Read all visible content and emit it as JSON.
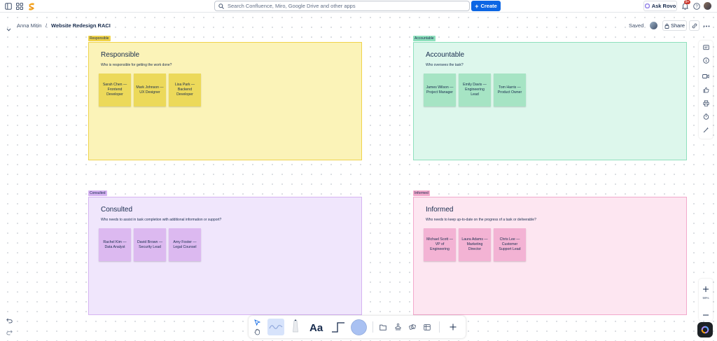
{
  "topbar": {
    "search_placeholder": "Search Confluence, Miro, Google Drive and other apps",
    "create_label": "Create",
    "ask_rovo_label": "Ask Rovo",
    "notification_count": "9+",
    "accent": "#0c66e4"
  },
  "breadcrumb": {
    "parent": "Anna Mitin",
    "separator": "/",
    "title": "Website Redesign RACI"
  },
  "header_actions": {
    "saved": "Saved",
    "share": "Share"
  },
  "frames": {
    "responsible": {
      "tag": "Responsible",
      "title": "Responsible",
      "question": "Who is responsible for getting the work done?",
      "color": "#fbf3b8",
      "border": "#f0d34a",
      "note_color": "#ecd95a",
      "notes": [
        "Sarah Chen — Frontend Developer",
        "Mark Johnson — UX Designer",
        "Lisa Park — Backend Developer"
      ]
    },
    "accountable": {
      "tag": "Accountable",
      "title": "Accountable",
      "question": "Who oversees the task?",
      "color": "#ddf7ec",
      "border": "#8fe0bd",
      "note_color": "#a6e4c4",
      "notes": [
        "James Wilson — Project Manager",
        "Emily Davis — Engineering Lead",
        "Tom Harris — Product Owner"
      ]
    },
    "consulted": {
      "tag": "Consulted",
      "title": "Consulted",
      "question": "Who needs to assist in task completion with additional information or support?",
      "color": "#f0e6fc",
      "border": "#d6b3f2",
      "note_color": "#dcb9f0",
      "notes": [
        "Rachel Kim — Data Analyst",
        "David Brown — Security Lead",
        "Amy Foster — Legal Counsel"
      ]
    },
    "informed": {
      "tag": "Informed",
      "title": "Informed",
      "question": "Who needs to keep up-to-date on the progress of a task or deliverable?",
      "color": "#fde6f1",
      "border": "#f2a9cc",
      "note_color": "#f3b3d4",
      "notes": [
        "Michael Scott — VP of Engineering",
        "Laura Adams — Marketing Director",
        "Chris Lee — Customer Support Lead"
      ]
    }
  },
  "zoom": {
    "level": "59%"
  }
}
